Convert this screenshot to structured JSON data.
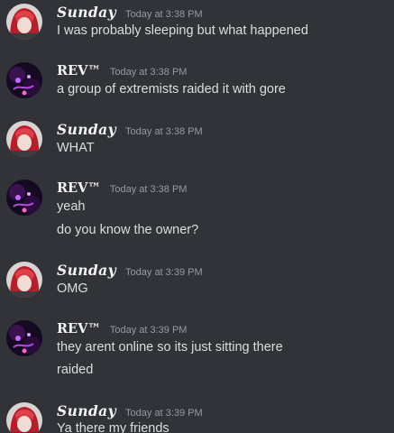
{
  "colors": {
    "background": "#313338",
    "username": "#f2f3f5",
    "timestamp": "#949ba4",
    "message_text": "#dbdee1"
  },
  "messages": [
    {
      "author": "Sunday",
      "avatar_icon": "red-haired-anime-avatar-icon",
      "timestamp": "Today at 3:38 PM",
      "lines": [
        "I was probably sleeping but what happened"
      ]
    },
    {
      "author": "REV™",
      "avatar_icon": "dark-purple-neon-avatar-icon",
      "timestamp": "Today at 3:38 PM",
      "lines": [
        "a group of extremists raided it with gore"
      ]
    },
    {
      "author": "Sunday",
      "avatar_icon": "red-haired-anime-avatar-icon",
      "timestamp": "Today at 3:38 PM",
      "lines": [
        "WHAT"
      ]
    },
    {
      "author": "REV™",
      "avatar_icon": "dark-purple-neon-avatar-icon",
      "timestamp": "Today at 3:38 PM",
      "lines": [
        "yeah",
        "do you know the owner?"
      ]
    },
    {
      "author": "Sunday",
      "avatar_icon": "red-haired-anime-avatar-icon",
      "timestamp": "Today at 3:39 PM",
      "lines": [
        "OMG"
      ]
    },
    {
      "author": "REV™",
      "avatar_icon": "dark-purple-neon-avatar-icon",
      "timestamp": "Today at 3:39 PM",
      "lines": [
        "they arent online so its just sitting there",
        "raided"
      ]
    },
    {
      "author": "Sunday",
      "avatar_icon": "red-haired-anime-avatar-icon",
      "timestamp": "Today at 3:39 PM",
      "lines": [
        "Ya there my friends"
      ]
    }
  ]
}
